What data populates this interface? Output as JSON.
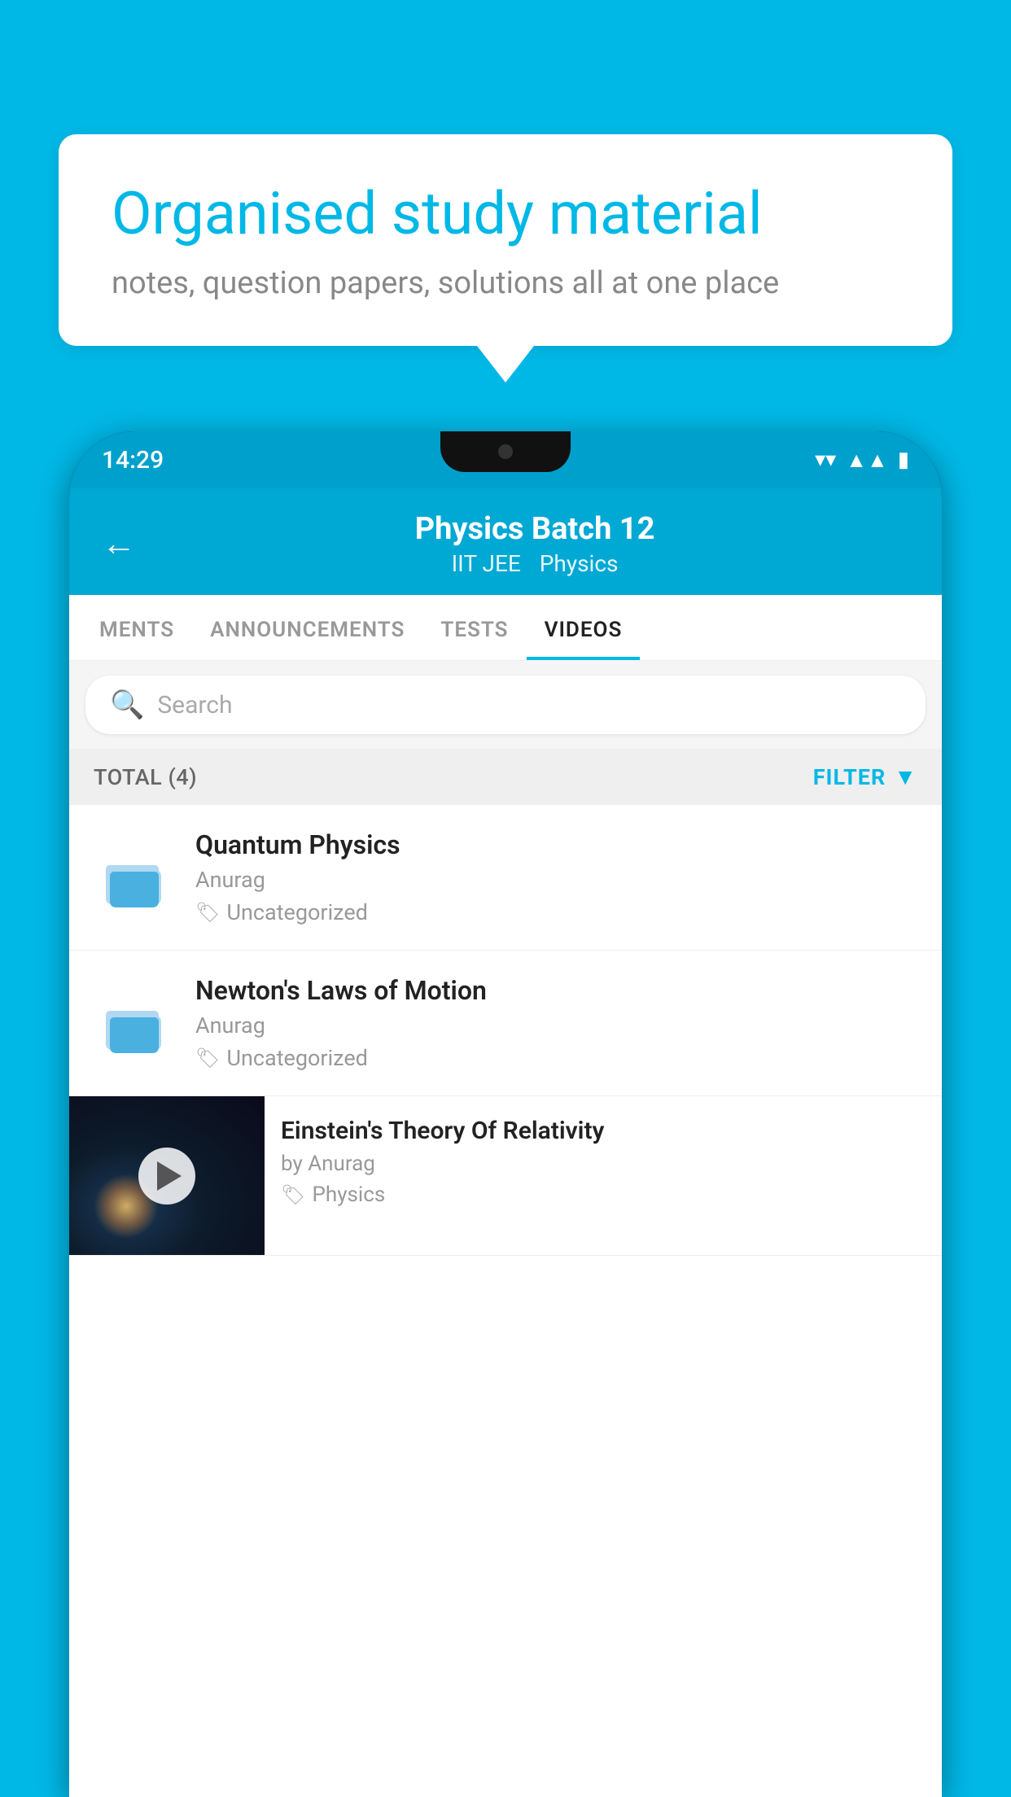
{
  "background_color": "#00b8e6",
  "speech_bubble": {
    "title": "Organised study material",
    "subtitle": "notes, question papers, solutions all at one place"
  },
  "phone": {
    "status_bar": {
      "time": "14:29",
      "wifi": "▼",
      "signal": "▲",
      "battery": "▮"
    },
    "header": {
      "back_label": "←",
      "title": "Physics Batch 12",
      "tags": [
        "IIT JEE",
        "Physics"
      ]
    },
    "tabs": [
      {
        "label": "MENTS",
        "active": false
      },
      {
        "label": "ANNOUNCEMENTS",
        "active": false
      },
      {
        "label": "TESTS",
        "active": false
      },
      {
        "label": "VIDEOS",
        "active": true
      }
    ],
    "search": {
      "placeholder": "Search"
    },
    "filter_bar": {
      "total_label": "TOTAL (4)",
      "filter_label": "FILTER"
    },
    "videos": [
      {
        "id": 1,
        "title": "Quantum Physics",
        "author": "Anurag",
        "tag": "Uncategorized",
        "has_thumbnail": false
      },
      {
        "id": 2,
        "title": "Newton's Laws of Motion",
        "author": "Anurag",
        "tag": "Uncategorized",
        "has_thumbnail": false
      },
      {
        "id": 3,
        "title": "Einstein's Theory Of Relativity",
        "author_label": "by Anurag",
        "tag": "Physics",
        "has_thumbnail": true
      }
    ]
  }
}
